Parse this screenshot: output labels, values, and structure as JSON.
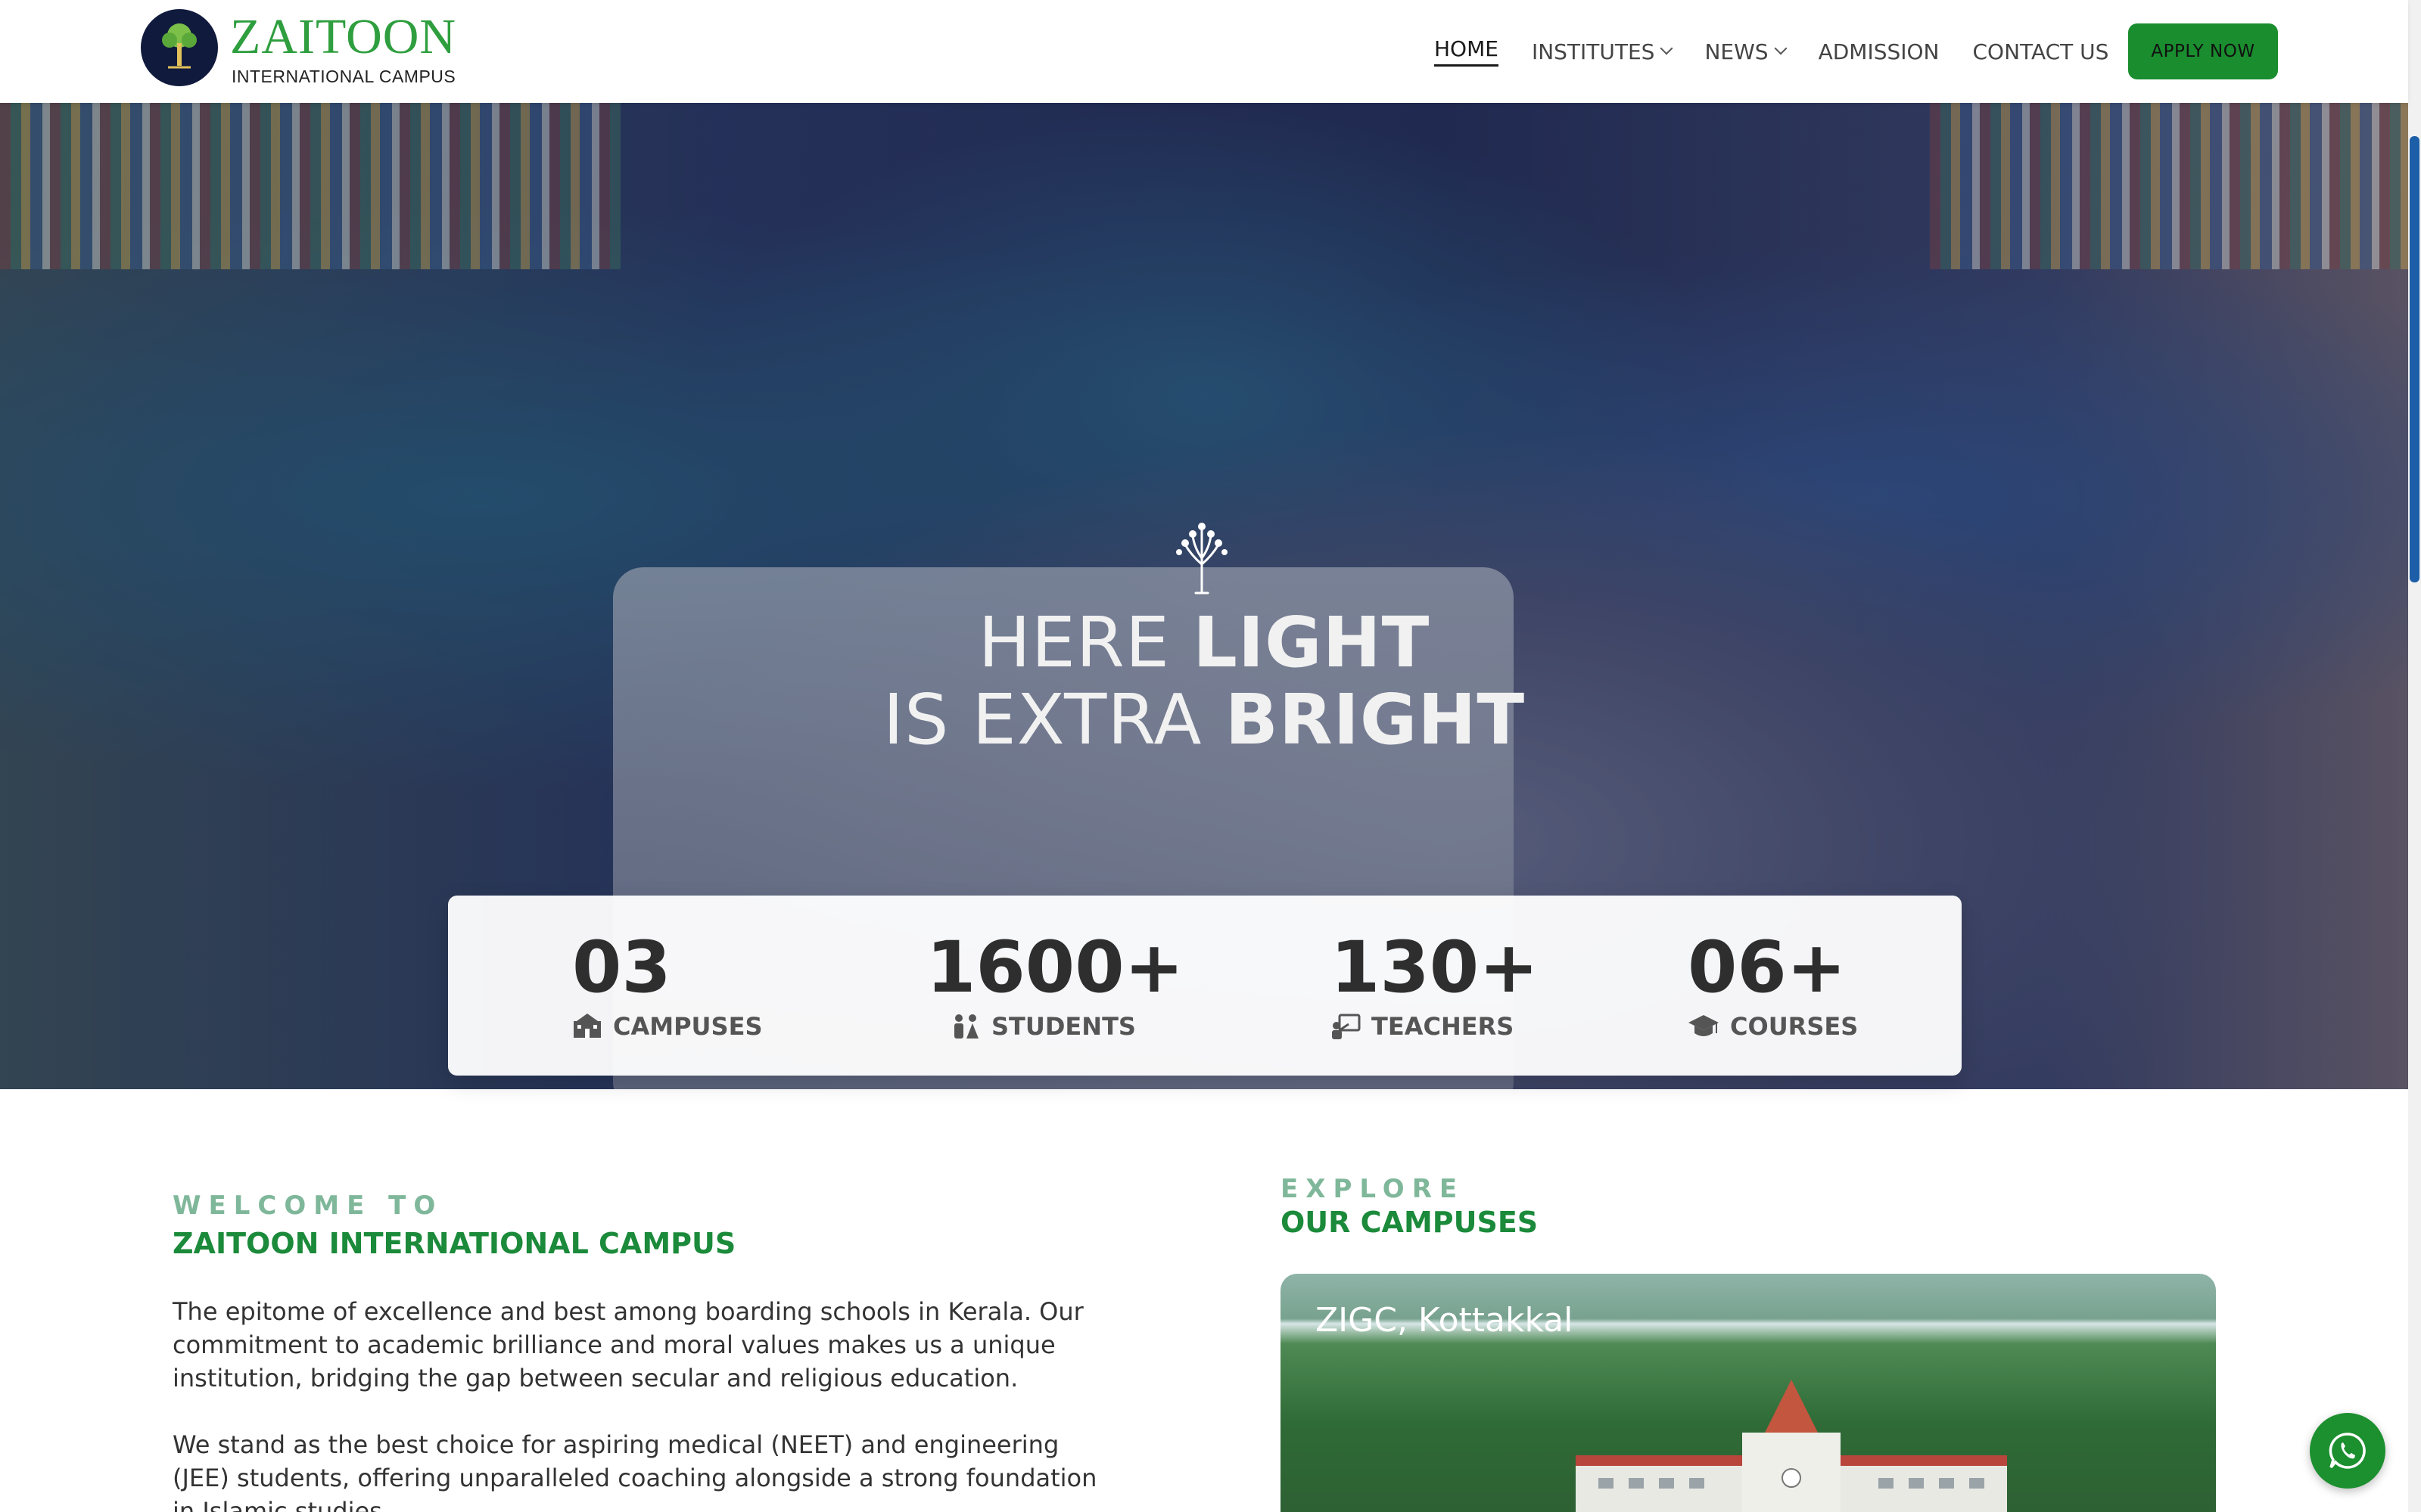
{
  "header": {
    "logo_title": "ZAITOON",
    "logo_subtitle": "INTERNATIONAL CAMPUS",
    "nav": [
      {
        "label": "HOME",
        "active": true
      },
      {
        "label": "INSTITUTES",
        "dropdown": true
      },
      {
        "label": "NEWS",
        "dropdown": true
      },
      {
        "label": "ADMISSION"
      },
      {
        "label": "CONTACT US"
      }
    ],
    "apply_label": "APPLY NOW",
    "accent_color": "#1a8d2f"
  },
  "hero": {
    "line1_light": "HERE ",
    "line1_bold": "LIGHT",
    "line2_light": "IS EXTRA ",
    "line2_bold": "BRIGHT",
    "emblem_icon": "tree-icon"
  },
  "stats": [
    {
      "value": "03",
      "label": "CAMPUSES",
      "icon": "school-icon"
    },
    {
      "value": "1600+",
      "label": "STUDENTS",
      "icon": "students-icon"
    },
    {
      "value": "130+",
      "label": "TEACHERS",
      "icon": "teacher-icon"
    },
    {
      "value": "06+",
      "label": "COURSES",
      "icon": "graduation-cap-icon"
    }
  ],
  "welcome": {
    "kicker": "WELCOME TO",
    "title": "ZAITOON INTERNATIONAL CAMPUS",
    "paragraph1": "The epitome of excellence and best among boarding schools in Kerala. Our commitment to academic brilliance and moral values makes us a unique institution, bridging the gap between secular and religious education.",
    "paragraph2": "We stand as the best choice for aspiring medical (NEET) and engineering (JEE) students, offering unparalleled coaching alongside a strong foundation in Islamic studies."
  },
  "explore": {
    "kicker": "EXPLORE",
    "title": "OUR CAMPUSES",
    "campus_name": "ZIGC, Kottakkal"
  },
  "floating": {
    "icon": "whatsapp-icon"
  }
}
